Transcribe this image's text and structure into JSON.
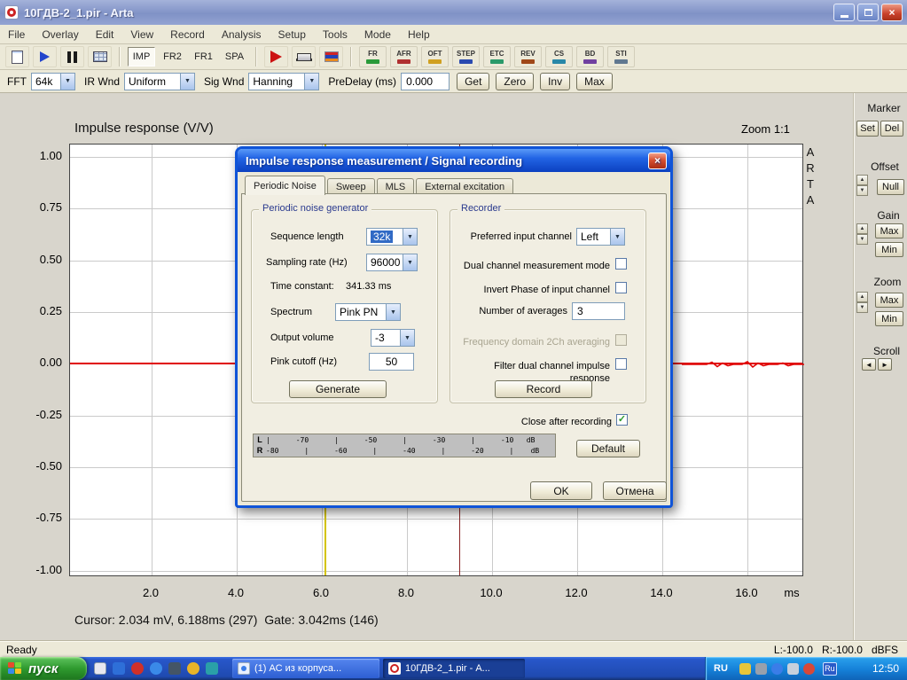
{
  "icons": {
    "dropdown": "▼",
    "up": "▲",
    "down": "▼",
    "left": "◄",
    "right": "►",
    "close": "×",
    "check": "✓",
    "flag": "⚑"
  },
  "window": {
    "title": "10ГДВ-2_1.pir - Arta"
  },
  "menu": {
    "items": [
      "File",
      "Overlay",
      "Edit",
      "View",
      "Record",
      "Analysis",
      "Setup",
      "Tools",
      "Mode",
      "Help"
    ]
  },
  "toolbar": {
    "modes": [
      "IMP",
      "FR2",
      "FR1",
      "SPA"
    ],
    "tools": [
      "FR",
      "AFR",
      "OFT",
      "STEP",
      "ETC",
      "REV",
      "CS",
      "BD",
      "STI"
    ]
  },
  "controls": {
    "fft_label": "FFT",
    "fft_value": "64k",
    "ir_wnd_label": "IR Wnd",
    "ir_wnd_value": "Uniform",
    "sig_wnd_label": "Sig Wnd",
    "sig_wnd_value": "Hanning",
    "predelay_label": "PreDelay (ms)",
    "predelay_value": "0.000",
    "get": "Get",
    "zero": "Zero",
    "inv": "Inv",
    "max": "Max"
  },
  "chart": {
    "title": "Impulse response (V/V)",
    "zoom": "Zoom 1:1",
    "y_ticks": [
      "1.00",
      "0.75",
      "0.50",
      "0.25",
      "0.00",
      "-0.25",
      "-0.50",
      "-0.75",
      "-1.00"
    ],
    "x_ticks": [
      "2.0",
      "4.0",
      "6.0",
      "8.0",
      "10.0",
      "12.0",
      "14.0",
      "16.0"
    ],
    "x_unit": "ms",
    "cursor_text": "Cursor: 2.034 mV, 6.188ms (297)  Gate: 3.042ms (146)",
    "watermark": [
      "A",
      "R",
      "T",
      "A"
    ]
  },
  "panel": {
    "marker": "Marker",
    "set": "Set",
    "del": "Del",
    "offset": "Offset",
    "null": "Null",
    "gain": "Gain",
    "gain_max": "Max",
    "gain_min": "Min",
    "zoom": "Zoom",
    "zoom_max": "Max",
    "zoom_min": "Min",
    "scroll": "Scroll"
  },
  "status": {
    "left": "Ready",
    "right": "L:-100.0   R:-100.0   dBFS"
  },
  "dialog": {
    "title": "Impulse response measurement / Signal recording",
    "tabs": [
      "Periodic Noise",
      "Sweep",
      "MLS",
      "External excitation"
    ],
    "generator": {
      "title": "Periodic noise generator",
      "rows": {
        "sequence_label": "Sequence length",
        "sequence_value": "32k",
        "rate_label": "Sampling rate (Hz)",
        "rate_value": "96000",
        "time_label": "Time constant:",
        "time_value": "341.33 ms",
        "spectrum_label": "Spectrum",
        "spectrum_value": "Pink PN",
        "volume_label": "Output volume",
        "volume_value": "-3",
        "cutoff_label": "Pink cutoff (Hz)",
        "cutoff_value": "50"
      },
      "generate": "Generate"
    },
    "recorder": {
      "title": "Recorder",
      "input_label": "Preferred input channel",
      "input_value": "Left",
      "dual_label": "Dual channel measurement mode",
      "invert_label": "Invert Phase of input channel",
      "averages_label": "Number of averages",
      "averages_value": "3",
      "freq2ch_label": "Frequency domain 2Ch averaging",
      "filter_label": "Filter dual channel impulse response",
      "record": "Record"
    },
    "close_after_label": "Close after recording",
    "meter": {
      "l": "L",
      "r": "R",
      "scale_top": "|      -70      |      -50      |      -30      |      -10   dB",
      "scale_bottom": "-80      |      -60      |      -40      |      -20      |    dB"
    },
    "default": "Default",
    "ok": "OK",
    "cancel": "Отмена"
  },
  "taskbar": {
    "start": "пуск",
    "task1": "(1) АС из корпуса...",
    "task2": "10ГДВ-2_1.pir - А...",
    "lang": "RU",
    "lang_badge": "Ru",
    "clock": "12:50"
  }
}
